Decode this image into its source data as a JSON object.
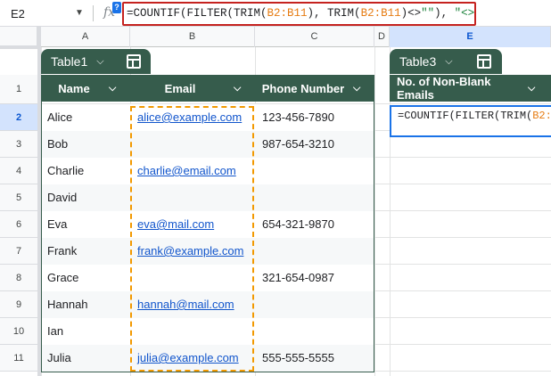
{
  "formula_bar": {
    "name_box": "E2",
    "fx": "fx",
    "help": "?",
    "formula_parts": [
      {
        "t": "=COUNTIF(FILTER(TRIM(",
        "c": "plain"
      },
      {
        "t": "B2:B11",
        "c": "ref"
      },
      {
        "t": "), TRIM(",
        "c": "plain"
      },
      {
        "t": "B2:B11",
        "c": "ref"
      },
      {
        "t": ")<>",
        "c": "plain"
      },
      {
        "t": "\"\"",
        "c": "str"
      },
      {
        "t": "), ",
        "c": "plain"
      },
      {
        "t": "\"<>\"",
        "c": "str"
      },
      {
        "t": ")",
        "c": "plain"
      }
    ]
  },
  "columns": [
    "A",
    "B",
    "C",
    "D",
    "E"
  ],
  "selected_column": "E",
  "rows": [
    "1",
    "2",
    "3",
    "4",
    "5",
    "6",
    "7",
    "8",
    "9",
    "10",
    "11"
  ],
  "selected_row": "2",
  "table1": {
    "name": "Table1",
    "headers": [
      "Name",
      "Email",
      "Phone Number"
    ],
    "data": [
      {
        "name": "Alice",
        "email": "alice@example.com",
        "phone": "123-456-7890"
      },
      {
        "name": "Bob",
        "email": "",
        "phone": "987-654-3210"
      },
      {
        "name": "Charlie",
        "email": "charlie@email.com",
        "phone": ""
      },
      {
        "name": "David",
        "email": "",
        "phone": ""
      },
      {
        "name": "Eva",
        "email": "eva@mail.com",
        "phone": "654-321-9870"
      },
      {
        "name": "Frank",
        "email": "frank@example.com",
        "phone": ""
      },
      {
        "name": "Grace",
        "email": "",
        "phone": "321-654-0987"
      },
      {
        "name": "Hannah",
        "email": "hannah@mail.com",
        "phone": ""
      },
      {
        "name": "Ian",
        "email": "",
        "phone": ""
      },
      {
        "name": "Julia",
        "email": "julia@example.com",
        "phone": "555-555-5555"
      }
    ]
  },
  "table3": {
    "name": "Table3",
    "header": "No. of Non-Blank Emails"
  },
  "colors": {
    "table_green": "#365c4c",
    "selection_blue": "#1a73e8",
    "formula_highlight_red": "#c5221f",
    "range_orange": "#f29900"
  }
}
